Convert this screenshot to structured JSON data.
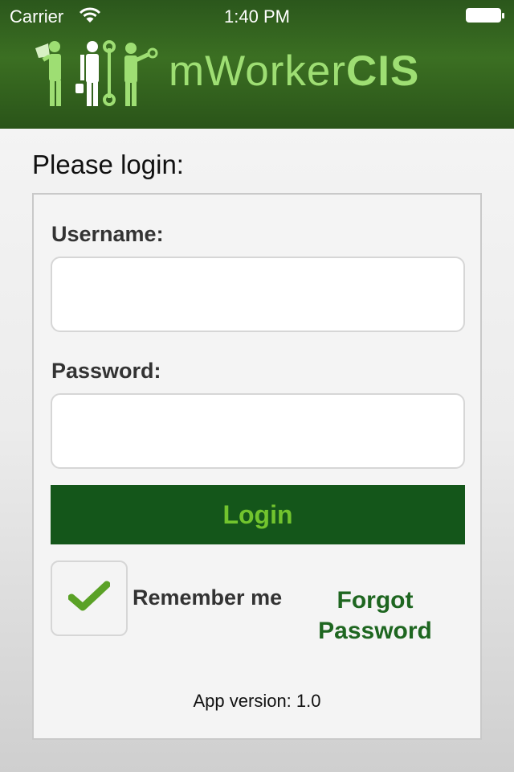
{
  "status_bar": {
    "carrier": "Carrier",
    "time": "1:40 PM"
  },
  "header": {
    "logo_prefix": "mWorker",
    "logo_suffix": "CIS",
    "logo_color": "#9ede73",
    "background_color": "#33611f"
  },
  "login_form": {
    "heading": "Please login:",
    "username_label": "Username:",
    "username_value": "",
    "password_label": "Password:",
    "password_value": "",
    "login_button_label": "Login",
    "login_button_color": "#14561a",
    "login_text_color": "#72c42e",
    "remember_me_label": "Remember me",
    "remember_me_checked": true,
    "forgot_password_label": "Forgot Password",
    "forgot_password_color": "#1e6620",
    "app_version": "App version: 1.0"
  },
  "icons": [
    "wifi-icon",
    "battery-icon",
    "workers-logo-icon",
    "checkmark-icon"
  ]
}
